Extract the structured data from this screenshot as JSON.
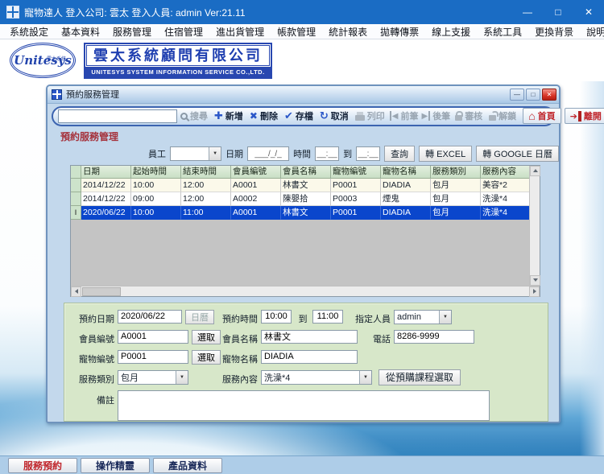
{
  "colors": {
    "titlebar_blue": "#1a6cc4",
    "accent_blue": "#2b57c8",
    "brand_blue": "#2847b0",
    "danger_red": "#c0262c",
    "header_green": "#cde3cb",
    "panel_green": "#d7e7c9",
    "selected_row_blue": "#0a46cc"
  },
  "window": {
    "title": "寵物達人 登入公司: 雲太 登入人員: admin Ver:21.11",
    "minimize": "—",
    "maximize": "□",
    "close": "✕"
  },
  "menu": {
    "items": [
      "系統設定",
      "基本資料",
      "服務管理",
      "住宿管理",
      "進出貨管理",
      "帳款管理",
      "統計報表",
      "拋轉傳票",
      "線上支援",
      "系統工具",
      "更換背景",
      "說明"
    ]
  },
  "logo": {
    "badge_script": "Unitesys",
    "badge_small": "雲太系統",
    "company_cn": "雲太系統顧問有限公司",
    "company_en": "UNITESYS SYSTEM INFORMATION SERVICE CO.,LTD."
  },
  "mdi": {
    "title": "預約服務管理",
    "controls": {
      "minimize": "—",
      "restore": "□",
      "close": "✕"
    },
    "toolbar": {
      "search_value": "",
      "buttons": [
        {
          "label": "搜尋",
          "icon": "search-icon",
          "enabled": false
        },
        {
          "label": "新增",
          "icon": "plus-icon",
          "enabled": true
        },
        {
          "label": "刪除",
          "icon": "cross-icon",
          "enabled": true
        },
        {
          "label": "存檔",
          "icon": "check-icon",
          "enabled": true
        },
        {
          "label": "取消",
          "icon": "undo-icon",
          "enabled": true
        },
        {
          "label": "列印",
          "icon": "printer-icon",
          "enabled": false
        },
        {
          "label": "前筆",
          "icon": "prev-record-icon",
          "enabled": false
        },
        {
          "label": "後筆",
          "icon": "next-record-icon",
          "enabled": false
        },
        {
          "label": "審核",
          "icon": "lock-icon",
          "enabled": false
        },
        {
          "label": "解鎖",
          "icon": "unlock-icon",
          "enabled": false
        }
      ],
      "home_label": "首頁",
      "exit_label": "離開"
    },
    "heading": "預約服務管理",
    "filter": {
      "staff_label": "員工",
      "staff_value": "",
      "date_label": "日期",
      "date_mask": "___/_/_",
      "time_label": "時間",
      "time_mask_from": "__:__",
      "to_label": "到",
      "time_mask_to": "__:__",
      "query_button": "查詢",
      "excel_button": "轉 EXCEL",
      "google_button": "轉 GOOGLE 日曆"
    },
    "table": {
      "headers": [
        "日期",
        "起始時間",
        "結束時間",
        "會員編號",
        "會員名稱",
        "寵物編號",
        "寵物名稱",
        "服務類別",
        "服務內容"
      ],
      "rows": [
        [
          "2014/12/22",
          "10:00",
          "12:00",
          "A0001",
          "林書文",
          "P0001",
          "DIADIA",
          "包月",
          "美容*2"
        ],
        [
          "2014/12/22",
          "09:00",
          "12:00",
          "A0002",
          "陳嬰拾",
          "P0003",
          "煙鬼",
          "包月",
          "洗澡*4"
        ],
        [
          "2020/06/22",
          "10:00",
          "11:00",
          "A0001",
          "林書文",
          "P0001",
          "DIADIA",
          "包月",
          "洗澡*4"
        ]
      ],
      "selected_row_index": 2,
      "selected_marker": "I"
    },
    "form": {
      "date_label": "預約日期",
      "date_value": "2020/06/22",
      "calendar_button": "日曆",
      "time_label": "預約時間",
      "time_from": "10:00",
      "to_label": "到",
      "time_to": "11:00",
      "staff_label": "指定人員",
      "staff_value": "admin",
      "member_no_label": "會員編號",
      "member_no": "A0001",
      "pick_button": "選取",
      "member_name_label": "會員名稱",
      "member_name": "林書文",
      "phone_label": "電話",
      "phone": "8286-9999",
      "pet_no_label": "寵物編號",
      "pet_no": "P0001",
      "pick_button2": "選取",
      "pet_name_label": "寵物名稱",
      "pet_name": "DIADIA",
      "category_label": "服務類別",
      "category_value": "包月",
      "content_label": "服務內容",
      "content_value": "洗澡*4",
      "from_course_button": "從預購課程選取",
      "note_label": "備註",
      "note_value": ""
    }
  },
  "tabs": {
    "items": [
      {
        "label": "服務預約",
        "active": true
      },
      {
        "label": "操作精靈",
        "active": false
      },
      {
        "label": "產品資料",
        "active": false
      }
    ]
  }
}
